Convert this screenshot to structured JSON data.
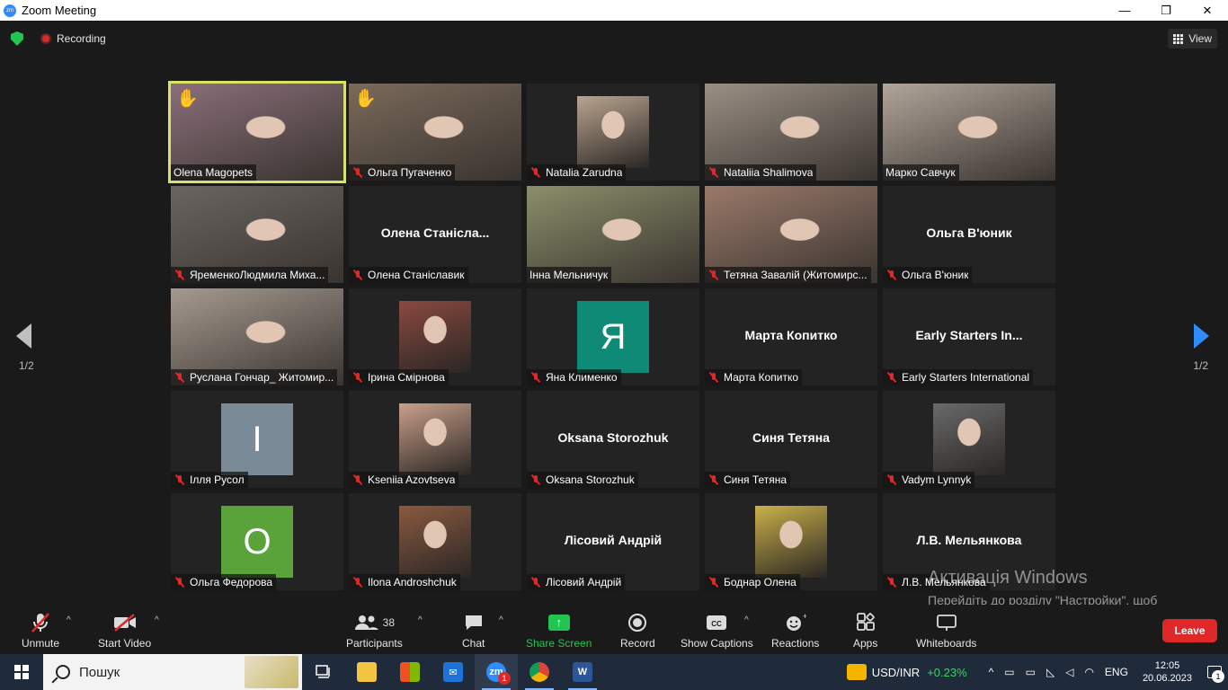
{
  "window": {
    "title": "Zoom Meeting",
    "minimize": "—",
    "maximize": "❐",
    "close": "✕"
  },
  "topbar": {
    "recording_label": "Recording",
    "view_label": "View"
  },
  "page": {
    "current": "1/2"
  },
  "tiles": [
    {
      "name": "Olena Magopets",
      "type": "video",
      "hand": true,
      "muted": false,
      "active": true,
      "bg": "#8a6f7a"
    },
    {
      "name": "Ольга Пугаченко",
      "type": "video",
      "hand": true,
      "muted": true,
      "bg": "#7a6a5a"
    },
    {
      "name": "Natalia Zarudna",
      "type": "thumb",
      "muted": true,
      "bg": "#b9a58f"
    },
    {
      "name": "Nataliia Shalimova",
      "type": "video",
      "muted": true,
      "bg": "#9a8f84"
    },
    {
      "name": "Марко Савчук",
      "type": "video",
      "muted": false,
      "bg": "#b1a59a"
    },
    {
      "name": "ЯременкоЛюдмила Миха...",
      "type": "video",
      "muted": true,
      "bg": "#6a6560"
    },
    {
      "name": "Олена Станіславик",
      "type": "name",
      "display": "Олена  Станісла...",
      "muted": true
    },
    {
      "name": "Інна Мельничук",
      "type": "video",
      "muted": false,
      "bg": "#8a8f6a"
    },
    {
      "name": "Тетяна Завалій (Житомирс...",
      "type": "video",
      "muted": true,
      "bg": "#9a7a6a"
    },
    {
      "name": "Ольга В'юник",
      "type": "name",
      "display": "Ольга В'юник",
      "muted": true
    },
    {
      "name": "Руслана Гончар_ Житомир...",
      "type": "video",
      "muted": true,
      "bg": "#a59a90"
    },
    {
      "name": "Ірина Смірнова",
      "type": "thumb",
      "muted": true,
      "bg": "#8a4a40"
    },
    {
      "name": "Яна Клименко",
      "type": "avatar",
      "letter": "Я",
      "color": "#0e8a76",
      "muted": true
    },
    {
      "name": "Марта Копитко",
      "type": "name",
      "display": "Марта Копитко",
      "muted": true
    },
    {
      "name": "Early Starters International",
      "type": "name",
      "display": "Early Starters  In...",
      "muted": true
    },
    {
      "name": "Ілля Русол",
      "type": "avatar",
      "letter": "І",
      "color": "#7a8a96",
      "muted": true
    },
    {
      "name": "Kseniia Azovtseva",
      "type": "thumb",
      "muted": true,
      "bg": "#c9a08a"
    },
    {
      "name": "Oksana Storozhuk",
      "type": "name",
      "display": "Oksana Storozhuk",
      "muted": true
    },
    {
      "name": "Синя Тетяна",
      "type": "name",
      "display": "Синя Тетяна",
      "muted": true
    },
    {
      "name": "Vadym Lynnyk",
      "type": "thumb",
      "muted": true,
      "bg": "#6a6a6a"
    },
    {
      "name": "Ольга Федорова",
      "type": "avatar",
      "letter": "О",
      "color": "#5aa33a",
      "muted": true
    },
    {
      "name": "Ilona Androshchuk",
      "type": "thumb",
      "muted": true,
      "bg": "#8a5a40"
    },
    {
      "name": "Лісовий Андрій",
      "type": "name",
      "display": "Лісовий Андрій",
      "muted": true
    },
    {
      "name": "Боднар Олена",
      "type": "thumb",
      "muted": true,
      "bg": "#c9b04a"
    },
    {
      "name": "Л.В. Мельянкова",
      "type": "name",
      "display": "Л.В. Мельянкова",
      "muted": true
    }
  ],
  "toolbar": {
    "unmute": "Unmute",
    "start_video": "Start Video",
    "participants": "Participants",
    "participants_count": "38",
    "chat": "Chat",
    "share_screen": "Share Screen",
    "record": "Record",
    "show_captions": "Show Captions",
    "reactions": "Reactions",
    "apps": "Apps",
    "whiteboards": "Whiteboards",
    "leave": "Leave"
  },
  "watermark": {
    "title": "Активація Windows",
    "text": "Перейдіть до розділу \"Настройки\", щоб активувати Windows."
  },
  "taskbar": {
    "search_placeholder": "Пошук",
    "zoom_badge": "1",
    "fx_label": "USD/INR",
    "fx_change": "+0.23%",
    "lang": "ENG",
    "time": "12:05",
    "date": "20.06.2023",
    "notifications": "1"
  },
  "colors": {
    "accent": "#2d8cff",
    "share_green": "#23c552",
    "leave_red": "#e02828",
    "active_speaker": "#d7e26a"
  }
}
